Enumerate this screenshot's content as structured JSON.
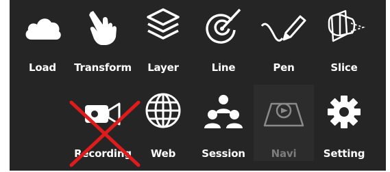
{
  "toolbar": {
    "background": "#252525",
    "row1": [
      {
        "label": "Load",
        "icon": "cloud-icon"
      },
      {
        "label": "Transform",
        "icon": "hand-icon"
      },
      {
        "label": "Layer",
        "icon": "layers-icon"
      },
      {
        "label": "Line",
        "icon": "line-target-icon"
      },
      {
        "label": "Pen",
        "icon": "pen-icon"
      },
      {
        "label": "Slice",
        "icon": "slice-icon"
      }
    ],
    "row2": [
      {
        "label": "Recording",
        "icon": "video-camera-icon",
        "disabled_mark": "red-x-icon"
      },
      {
        "label": "Web",
        "icon": "globe-icon"
      },
      {
        "label": "Session",
        "icon": "people-icon"
      },
      {
        "label": "Navi",
        "icon": "navigation-icon",
        "state": "disabled"
      },
      {
        "label": "Setting",
        "icon": "gear-icon"
      }
    ],
    "disabled_mark_color": "#e01b1b"
  }
}
